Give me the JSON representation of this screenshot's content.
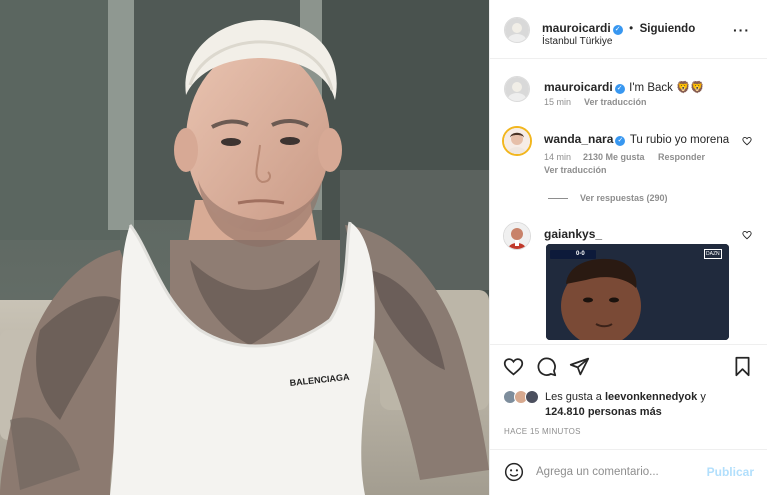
{
  "header": {
    "username": "mauroicardi",
    "verified": true,
    "separator": "•",
    "follow_label": "Siguiendo",
    "location": "İstanbul Türkiye",
    "more_icon": "more-dots-icon"
  },
  "caption": {
    "username": "mauroicardi",
    "text": "I'm Back 🦁🦁",
    "time": "15 min",
    "translate": "Ver traducción"
  },
  "comments": [
    {
      "username": "wanda_nara",
      "text": "Tu rubio yo morena",
      "time": "14 min",
      "likes": "2130 Me gusta",
      "reply": "Responder",
      "translate": "Ver traducción",
      "replies": "Ver respuestas (290)"
    },
    {
      "username": "gaiankys_",
      "clip_score": "0-0",
      "clip_badge": "DAZN"
    }
  ],
  "actions": {
    "icons": [
      "heart-icon",
      "comment-icon",
      "share-icon",
      "bookmark-icon"
    ],
    "likes_prefix": "Les gusta a",
    "likes_user": "leevonkennedyok",
    "likes_conj": "y",
    "likes_count": "124.810 personas más",
    "timestamp": "HACE 15 MINUTOS"
  },
  "comment_box": {
    "placeholder": "Agrega un comentario...",
    "publish": "Publicar",
    "emoji_icon": "emoji-icon"
  },
  "photo": {
    "shirt_text": "BALENCIAGA"
  },
  "colors": {
    "verified": "#3897f0",
    "publish": "#b2dffc",
    "muted": "#8e8e8e"
  }
}
